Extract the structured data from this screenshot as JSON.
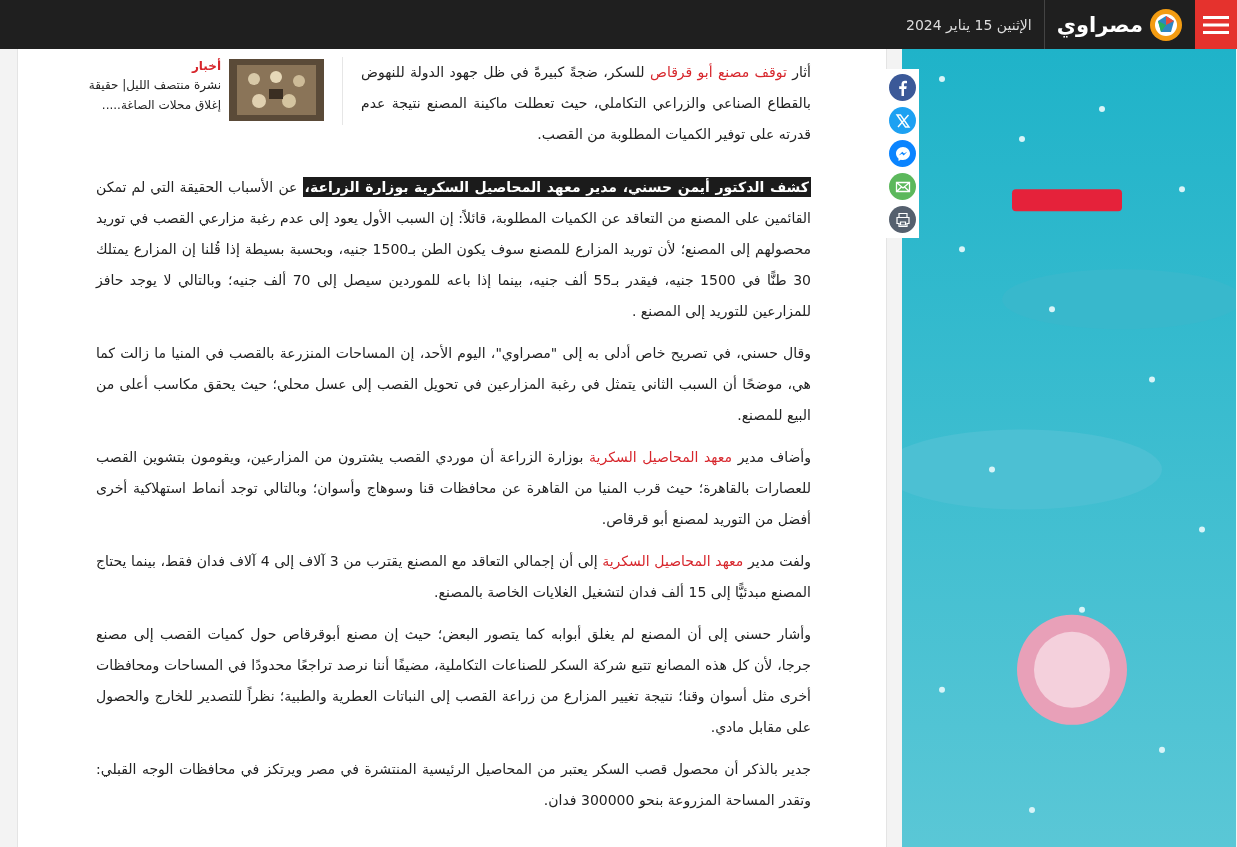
{
  "header": {
    "logo": "مصراوي",
    "date": "الإثنين 15 يناير 2024"
  },
  "related": {
    "category": "أخبار",
    "title": "نشرة منتصف الليل| حقيقة إغلاق محلات الصاغة....."
  },
  "share": [
    {
      "kind": "facebook"
    },
    {
      "kind": "x"
    },
    {
      "kind": "messenger"
    },
    {
      "kind": "email"
    },
    {
      "kind": "print"
    }
  ],
  "paragraphs": [
    {
      "segments": [
        {
          "kind": "text",
          "text": "أثار "
        },
        {
          "kind": "link",
          "text": "توقف مصنع أبو قرقاص"
        },
        {
          "kind": "text",
          "text": " للسكر، ضجةً كبيرةً في ظل جهود الدولة للنهوض بالقطاع الصناعي والزراعي التكاملي، حيث تعطلت ماكينة المصنع نتيجة عدم قدرته على توفير الكميات المطلوبة من القصب."
        }
      ]
    },
    {
      "segments": [
        {
          "kind": "highlight",
          "text": "كشف الدكتور أيمن حسني، مدير معهد المحاصيل السكرية بوزارة الزراعة،"
        },
        {
          "kind": "text",
          "text": " عن الأسباب الحقيقة التي لم تمكن القائمين على المصنع من التعاقد عن الكميات المطلوبة، قائلاً: إن السبب الأول يعود إلى عدم رغبة مزارعي القصب في توريد محصولهم إلى المصنع؛ لأن توريد المزارع للمصنع سوف يكون الطن بـ1500 جنيه، وبحسبة بسيطة إذا قُلنا إن المزارع يمتلك 30 طنًّا في 1500 جنيه، فيقدر بـ55 ألف جنيه، بينما إذا باعه للموردين سيصل إلى 70 ألف جنيه؛ وبالتالي لا يوجد حافز للمزارعين للتوريد إلى المصنع ."
        }
      ]
    },
    {
      "segments": [
        {
          "kind": "text",
          "text": "وقال حسني، في تصريح خاص أدلى به إلى \"مصراوي\"، اليوم الأحد، إن المساحات المنزرعة بالقصب في المنيا ما زالت كما هي، موضحًا أن السبب الثاني يتمثل في رغبة المزارعين في تحويل القصب إلى عسل محلي؛ حيث يحقق مكاسب أعلى من البيع للمصنع."
        }
      ]
    },
    {
      "segments": [
        {
          "kind": "text",
          "text": "وأضاف مدير "
        },
        {
          "kind": "link",
          "text": "معهد المحاصيل السكرية"
        },
        {
          "kind": "text",
          "text": " بوزارة الزراعة أن موردي القصب يشترون من المزارعين، ويقومون بتشوين القصب للعصارات بالقاهرة؛ حيث قرب المنيا من القاهرة عن محافظات قنا وسوهاج وأسوان؛ وبالتالي توجد أنماط استهلاكية أخرى أفضل من التوريد لمصنع أبو قرقاص."
        }
      ]
    },
    {
      "segments": [
        {
          "kind": "text",
          "text": "ولفت مدير "
        },
        {
          "kind": "link",
          "text": "معهد المحاصيل السكرية"
        },
        {
          "kind": "text",
          "text": " إلى أن إجمالي التعاقد مع المصنع يقترب من 3 آلاف إلى 4 آلاف فدان فقط، بينما يحتاج المصنع مبدئيًّا إلى 15 ألف فدان لتشغيل الغلايات الخاصة بالمصنع."
        }
      ]
    },
    {
      "segments": [
        {
          "kind": "text",
          "text": "وأشار حسني إلى أن المصنع لم يغلق أبوابه كما يتصور البعض؛ حيث إن مصنع أبوقرقاص حول كميات القصب إلى مصنع جرجا، لأن كل هذه المصانع تتبع شركة السكر للصناعات التكاملية، مضيفًا أننا نرصد تراجعًا محدودًا في المساحات ومحافظات أخرى مثل أسوان وقنا؛ نتيجة تغيير المزارع من زراعة القصب إلى النباتات العطرية والطبية؛ نظراً للتصدير للخارج والحصول على مقابل مادي."
        }
      ]
    },
    {
      "segments": [
        {
          "kind": "text",
          "text": "جدير بالذكر أن محصول قصب السكر يعتبر من المحاصيل الرئيسية المنتشرة في مصر ويرتكز في محافظات الوجه القبلي: وتقدر المساحة المزروعة بنحو 300000 فدان."
        }
      ]
    }
  ]
}
